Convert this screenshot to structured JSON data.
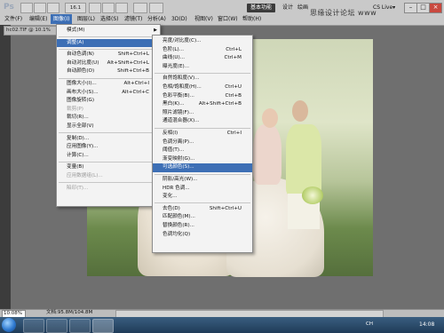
{
  "app": {
    "logo": "Ps",
    "doc_tab": "hc02.TIF @ 10.1%"
  },
  "menubar": [
    "文件(F)",
    "编辑(E)",
    "图像(I)",
    "图层(L)",
    "选择(S)",
    "滤镜(T)",
    "分析(A)",
    "3D(D)",
    "视图(V)",
    "窗口(W)",
    "帮助(H)"
  ],
  "toolbar": {
    "zoom_value": "16.1"
  },
  "workspace": {
    "button": "基本功能",
    "links": [
      "设计",
      "绘画"
    ],
    "cslive": "CS Live▾"
  },
  "watermark": "思缘设计论坛 www",
  "window_buttons": [
    "–",
    "□",
    "×"
  ],
  "image_menu": [
    {
      "label": "模式(M)",
      "shortcut": "",
      "arrow": true
    },
    {
      "sep": true
    },
    {
      "label": "调整(A)",
      "shortcut": "",
      "arrow": true,
      "highlight": true
    },
    {
      "sep": true
    },
    {
      "label": "自动色调(N)",
      "shortcut": "Shift+Ctrl+L"
    },
    {
      "label": "自动对比度(U)",
      "shortcut": "Alt+Shift+Ctrl+L"
    },
    {
      "label": "自动颜色(O)",
      "shortcut": "Shift+Ctrl+B"
    },
    {
      "sep": true
    },
    {
      "label": "图像大小(I)...",
      "shortcut": "Alt+Ctrl+I"
    },
    {
      "label": "画布大小(S)...",
      "shortcut": "Alt+Ctrl+C"
    },
    {
      "label": "图像旋转(G)",
      "shortcut": "",
      "arrow": true
    },
    {
      "label": "裁剪(P)",
      "shortcut": "",
      "disabled": true
    },
    {
      "label": "裁切(R)...",
      "shortcut": ""
    },
    {
      "label": "显示全部(V)",
      "shortcut": ""
    },
    {
      "sep": true
    },
    {
      "label": "复制(D)...",
      "shortcut": ""
    },
    {
      "label": "应用图像(Y)...",
      "shortcut": ""
    },
    {
      "label": "计算(C)...",
      "shortcut": ""
    },
    {
      "sep": true
    },
    {
      "label": "变量(B)",
      "shortcut": "",
      "arrow": true
    },
    {
      "label": "应用数据组(L)...",
      "shortcut": "",
      "disabled": true
    },
    {
      "sep": true
    },
    {
      "label": "陷印(T)...",
      "shortcut": "",
      "disabled": true
    }
  ],
  "adjust_menu": [
    {
      "label": "亮度/对比度(C)...",
      "shortcut": ""
    },
    {
      "label": "色阶(L)...",
      "shortcut": "Ctrl+L"
    },
    {
      "label": "曲线(U)...",
      "shortcut": "Ctrl+M"
    },
    {
      "label": "曝光度(E)...",
      "shortcut": ""
    },
    {
      "sep": true
    },
    {
      "label": "自然饱和度(V)...",
      "shortcut": ""
    },
    {
      "label": "色相/饱和度(H)...",
      "shortcut": "Ctrl+U"
    },
    {
      "label": "色彩平衡(B)...",
      "shortcut": "Ctrl+B"
    },
    {
      "label": "黑白(K)...",
      "shortcut": "Alt+Shift+Ctrl+B"
    },
    {
      "label": "照片滤镜(F)...",
      "shortcut": ""
    },
    {
      "label": "通道混合器(X)...",
      "shortcut": ""
    },
    {
      "sep": true
    },
    {
      "label": "反相(I)",
      "shortcut": "Ctrl+I"
    },
    {
      "label": "色调分离(P)...",
      "shortcut": ""
    },
    {
      "label": "阈值(T)...",
      "shortcut": ""
    },
    {
      "label": "渐变映射(G)...",
      "shortcut": ""
    },
    {
      "label": "可选颜色(S)...",
      "shortcut": "",
      "highlight": true
    },
    {
      "sep": true
    },
    {
      "label": "阴影/高光(W)...",
      "shortcut": ""
    },
    {
      "label": "HDR 色调...",
      "shortcut": ""
    },
    {
      "label": "变化...",
      "shortcut": ""
    },
    {
      "sep": true
    },
    {
      "label": "去色(D)",
      "shortcut": "Shift+Ctrl+U"
    },
    {
      "label": "匹配颜色(M)...",
      "shortcut": ""
    },
    {
      "label": "替换颜色(R)...",
      "shortcut": ""
    },
    {
      "label": "色调均化(Q)",
      "shortcut": ""
    }
  ],
  "status": {
    "zoom": "10.08%",
    "doc": "文档:95.8M/104.8M"
  },
  "taskbar": {
    "lang": "CH",
    "clock": "14:08"
  },
  "colors": {
    "accent": "#3d6fb5",
    "menu_bg": "#f3f3f3"
  }
}
